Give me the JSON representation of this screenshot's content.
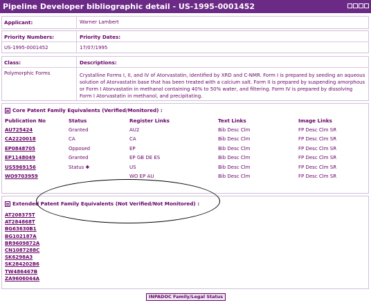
{
  "window": {
    "title": "Pipeline Developer bibliographic detail - US-1995-0001452"
  },
  "applicant": {
    "label": "Applicant:",
    "value": "Warner Lambert"
  },
  "priority": {
    "numbers_label": "Priority Numbers:",
    "numbers_value": "US-1995-0001452",
    "dates_label": "Priority Dates:",
    "dates_value": "17/07/1995"
  },
  "classification": {
    "class_label": "Class:",
    "class_value": "Polymorphic Forms",
    "desc_label": "Descriptions:",
    "desc_value": "Crystalline Forms I, II, and IV of Atorvastatin, identified by XRD and C-NMR. Form I is prepared by seeding an aqueous solution of Atorvastatin base that has been treated with a calcium salt. Form II is prepared by suspending amorphous or Form I Atorvastatin in methanol containing 40% to 50% water, and filtering. Form IV is prepared by dissolving Form I Atorvastatin in methanol, and precipitating."
  },
  "core": {
    "heading": "Core Patent Family Equivalents (Verified/Monitored) :",
    "columns": [
      "Publication No",
      "Status",
      "Register Links",
      "Text Links",
      "Image Links"
    ],
    "rows": [
      {
        "pub": "AU725424",
        "status": "Granted",
        "register": "AU2",
        "text": "Bib Desc Clm",
        "image": "FP Desc Clm SR"
      },
      {
        "pub": "CA2220018",
        "status": "CA",
        "register": "CA",
        "text": "Bib Desc Clm",
        "image": "FP Desc Clm SR"
      },
      {
        "pub": "EP0848705",
        "status": "Opposed",
        "register": "EP",
        "text": "Bib Desc Clm",
        "image": "FP Desc Clm SR"
      },
      {
        "pub": "EP1148049",
        "status": "Granted",
        "register": "EP GB DE ES",
        "text": "Bib Desc Clm",
        "image": "FP Desc Clm SR"
      },
      {
        "pub": "US5969156",
        "status": "Status ✱",
        "register": "US",
        "text": "Bib Desc Clm",
        "image": "FP Desc Clm SR"
      },
      {
        "pub": "WO9703959",
        "status": "",
        "register": "WO EP AU",
        "text": "Bib Desc Clm",
        "image": "FP Desc Clm SR"
      }
    ]
  },
  "extended": {
    "heading": "Extended Patent Family Equivalents (Not Verified/Not Monitored) :",
    "items": [
      "AT208375T",
      "AT284868T",
      "BG63630B1",
      "BG102187A",
      "BR9609872A",
      "CN1087288C",
      "SK6298A3",
      "SK284202B6",
      "TW486467B",
      "ZA9606044A"
    ]
  },
  "footer": {
    "button": "INPADOC Family/Legal Status"
  }
}
